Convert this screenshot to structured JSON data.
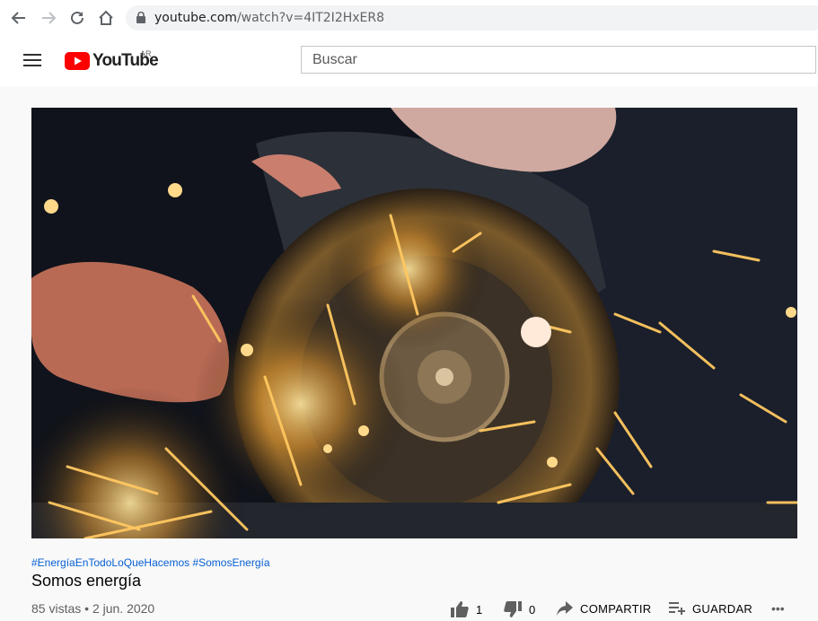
{
  "browser": {
    "url_host": "youtube.com",
    "url_path": "/watch?v=4IT2I2HxER8"
  },
  "header": {
    "logo_text": "YouTube",
    "country_code": "AR",
    "search_placeholder": "Buscar"
  },
  "video": {
    "hashtags": "#EnergíaEnTodoLoQueHacemos #SomosEnergía",
    "title": "Somos energía",
    "views": "85 vistas",
    "date": "2 jun. 2020",
    "separator": "•"
  },
  "actions": {
    "like_count": "1",
    "dislike_count": "0",
    "share_label": "COMPARTIR",
    "save_label": "GUARDAR",
    "more": "•••"
  },
  "colors": {
    "brand_red": "#ff0000",
    "link_blue": "#065fd4",
    "muted": "#606060"
  }
}
